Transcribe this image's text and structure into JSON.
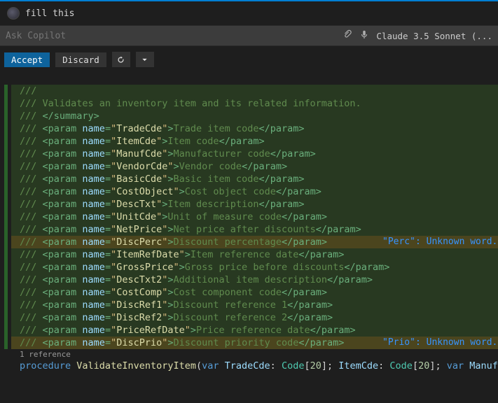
{
  "user_prompt": "fill this",
  "ask_placeholder": "Ask Copilot",
  "model_name": "Claude 3.5 Sonnet (...",
  "actions": {
    "accept": "Accept",
    "discard": "Discard"
  },
  "doc": {
    "summary_open": "/// <summary>",
    "summary_text": "/// Validates an inventory item and its related information.",
    "summary_close": "/// </summary>",
    "params": [
      {
        "name": "TradeCde",
        "desc": "Trade item code"
      },
      {
        "name": "ItemCde",
        "desc": "Item code"
      },
      {
        "name": "ManufCde",
        "desc": "Manufacturer code"
      },
      {
        "name": "VendorCde",
        "desc": "Vendor code"
      },
      {
        "name": "BasicCde",
        "desc": "Basic item code"
      },
      {
        "name": "CostObject",
        "desc": "Cost object code"
      },
      {
        "name": "DescTxt",
        "desc": "Item description"
      },
      {
        "name": "UnitCde",
        "desc": "Unit of measure code"
      },
      {
        "name": "NetPrice",
        "desc": "Net price after discounts"
      },
      {
        "name": "DiscPerc",
        "desc": "Discount percentage"
      },
      {
        "name": "ItemRefDate",
        "desc": "Item reference date"
      },
      {
        "name": "GrossPrice",
        "desc": "Gross price before discounts"
      },
      {
        "name": "DescTxt2",
        "desc": "Additional item description"
      },
      {
        "name": "CostComp",
        "desc": "Cost component code"
      },
      {
        "name": "DiscRef1",
        "desc": "Discount reference 1"
      },
      {
        "name": "DiscRef2",
        "desc": "Discount reference 2"
      },
      {
        "name": "PriceRefDate",
        "desc": "Price reference date"
      },
      {
        "name": "DiscPrio",
        "desc": "Discount priority code"
      }
    ]
  },
  "warnings": [
    {
      "text": "\"Perc\": Unknown word.",
      "line_index": 9
    },
    {
      "text": "\"Prio\": Unknown word.",
      "line_index": 17
    }
  ],
  "references_label": "1 reference",
  "procedure": {
    "keyword": "procedure",
    "name": "ValidateInventoryItem",
    "sig_parts": [
      {
        "t": "(",
        "c": "plain"
      },
      {
        "t": "var ",
        "c": "keyword"
      },
      {
        "t": "TradeCde",
        "c": "attr"
      },
      {
        "t": ": ",
        "c": "plain"
      },
      {
        "t": "Code",
        "c": "type"
      },
      {
        "t": "[",
        "c": "plain"
      },
      {
        "t": "20",
        "c": "num"
      },
      {
        "t": "]; ",
        "c": "plain"
      },
      {
        "t": "ItemCde",
        "c": "attr"
      },
      {
        "t": ": ",
        "c": "plain"
      },
      {
        "t": "Code",
        "c": "type"
      },
      {
        "t": "[",
        "c": "plain"
      },
      {
        "t": "20",
        "c": "num"
      },
      {
        "t": "]; ",
        "c": "plain"
      },
      {
        "t": "var ",
        "c": "keyword"
      },
      {
        "t": "ManufCd",
        "c": "attr"
      }
    ]
  }
}
